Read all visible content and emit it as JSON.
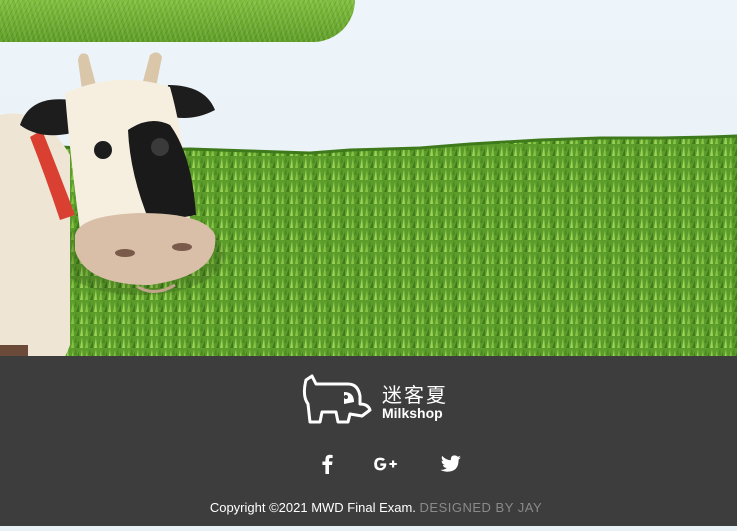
{
  "footer": {
    "logo": {
      "cn": "迷客夏",
      "en": "Milkshop"
    },
    "social": [
      {
        "name": "facebook-icon"
      },
      {
        "name": "google-plus-icon"
      },
      {
        "name": "twitter-icon"
      }
    ],
    "copyright": "Copyright ©2021 MWD Final Exam.",
    "designed_by": "DESIGNED BY JAY"
  },
  "colors": {
    "footer_bg": "#3d3d3d",
    "grass": "#5a9a2a",
    "sky": "#e9f2f7",
    "cow_collar": "#d94032"
  }
}
